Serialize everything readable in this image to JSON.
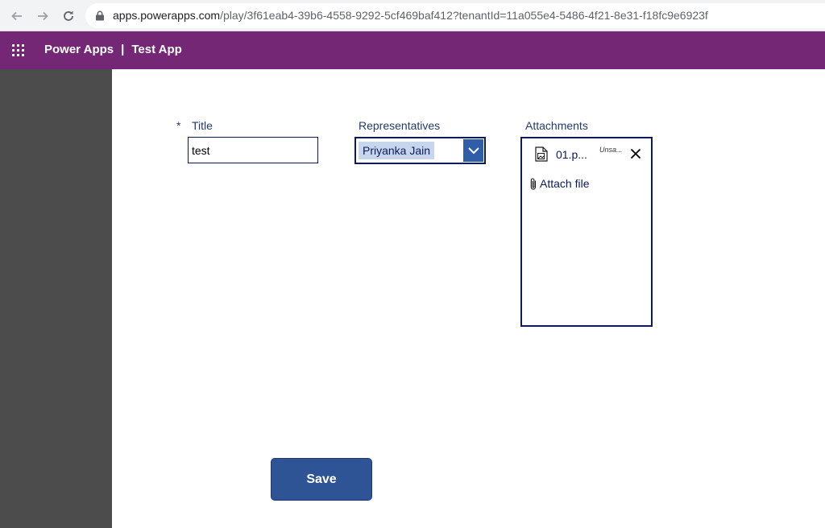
{
  "browser": {
    "url_host": "apps.powerapps.com",
    "url_path": "/play/3f61eab4-39b6-4558-9292-5cf469baf412?tenantId=11a055e4-5486-4f21-8e31-f18fc9e6923f",
    "icons": [
      "back-arrow-icon",
      "forward-arrow-icon",
      "reload-icon",
      "lock-icon"
    ]
  },
  "header": {
    "app_name": "Power Apps",
    "separator": "|",
    "page_title": "Test App",
    "icon": "waffle-icon",
    "background_color": "#742774"
  },
  "form": {
    "title_field": {
      "required_marker": "*",
      "label": "Title",
      "value": "test"
    },
    "representatives_field": {
      "label": "Representatives",
      "selected_value": "Priyanka Jain",
      "icon": "chevron-down-icon"
    },
    "attachments_field": {
      "label": "Attachments",
      "files": [
        {
          "name": "01.p...",
          "status": "Unsa...",
          "icon": "file-image-icon",
          "remove_icon": "close-icon"
        }
      ],
      "attach_label": "Attach file",
      "attach_icon": "paperclip-icon"
    },
    "save_label": "Save"
  },
  "colors": {
    "left_rail": "#4c4c4c",
    "label_text": "#243a6e",
    "control_border": "#0c1a5a",
    "button_bg": "#2f5496"
  }
}
